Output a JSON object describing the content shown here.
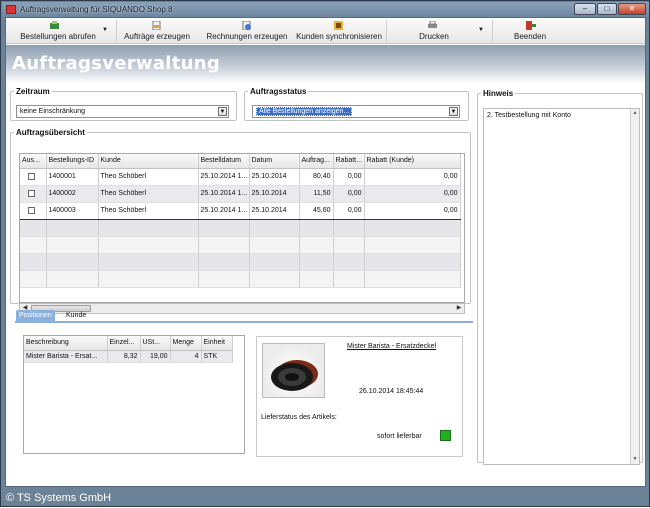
{
  "window": {
    "title": "Auftragsverwaltung für SIQUANDO Shop 8",
    "controls": {
      "minimize": "–",
      "maximize": "□",
      "close": "✕"
    }
  },
  "toolbar": {
    "items": [
      {
        "label": "Bestellungen abrufen",
        "icon": "download-orders-icon",
        "dropdown": true
      },
      {
        "label": "Aufträge erzeugen",
        "icon": "create-orders-icon",
        "dropdown": false
      },
      {
        "label": "Rechnungen erzeugen",
        "icon": "create-invoices-icon",
        "dropdown": false
      },
      {
        "label": "Kunden synchronisieren",
        "icon": "sync-customers-icon",
        "dropdown": false
      },
      {
        "label": "Drucken",
        "icon": "printer-icon",
        "dropdown": true
      },
      {
        "label": "Beenden",
        "icon": "exit-icon",
        "dropdown": false
      }
    ],
    "dropdown_glyph": "▼"
  },
  "header": {
    "title": "Auftragsverwaltung"
  },
  "zeitraum": {
    "legend": "Zeitraum",
    "value": "keine Einschränkung"
  },
  "auftragsstatus": {
    "legend": "Auftragsstatus",
    "value": "Alle Bestellungen anzeigen..."
  },
  "combo_arrow": "▼",
  "orders": {
    "legend": "Auftragsübersicht",
    "columns": [
      "Aus...",
      "Bestellungs-ID",
      "Kunde",
      "Bestelldatum",
      "Datum",
      "Auftrag...",
      "Rabatt...",
      "Rabatt (Kunde)"
    ],
    "rows": [
      {
        "id": "1400001",
        "customer": "Theo Schöberl",
        "ordered": "25.10.2014 1...",
        "date": "25.10.2014",
        "amount": "80,40",
        "discount": "0,00",
        "customer_discount": "0,00",
        "selected": false
      },
      {
        "id": "1400002",
        "customer": "Theo Schöberl",
        "ordered": "25.10.2014 1...",
        "date": "25.10.2014",
        "amount": "11,50",
        "discount": "0,00",
        "customer_discount": "0,00",
        "selected": false
      },
      {
        "id": "1400003",
        "customer": "Theo Schöberl",
        "ordered": "25.10.2014 1...",
        "date": "25.10.2014",
        "amount": "45,60",
        "discount": "0,00",
        "customer_discount": "0,00",
        "selected": false
      }
    ],
    "scroll_left": "◀",
    "scroll_right": "▶"
  },
  "tabs": [
    {
      "label": "Positionen",
      "active": true
    },
    {
      "label": "Kunde",
      "active": false
    }
  ],
  "positions": {
    "columns": [
      "Beschreibung",
      "Einzel...",
      "USt...",
      "Menge",
      "Einheit"
    ],
    "rows": [
      {
        "description": "Mister Barista - Ersat...",
        "price": "8,32",
        "tax": "19,00",
        "qty": "4",
        "unit": "STK"
      }
    ]
  },
  "product": {
    "name": "Mister Barista - Ersatzdeckel",
    "timestamp": "26.10.2014 18:45:44",
    "delivery_label": "Lieferstatus des Artikels:",
    "delivery_status": "sofort lieferbar",
    "status_color": "#22b022"
  },
  "hinweis": {
    "legend": "Hinweis",
    "items": [
      "2. Testbestellung mit Konto"
    ],
    "scroll_up": "▲",
    "scroll_down": "▼"
  },
  "footer": {
    "copyright": "© TS Systems GmbH"
  }
}
